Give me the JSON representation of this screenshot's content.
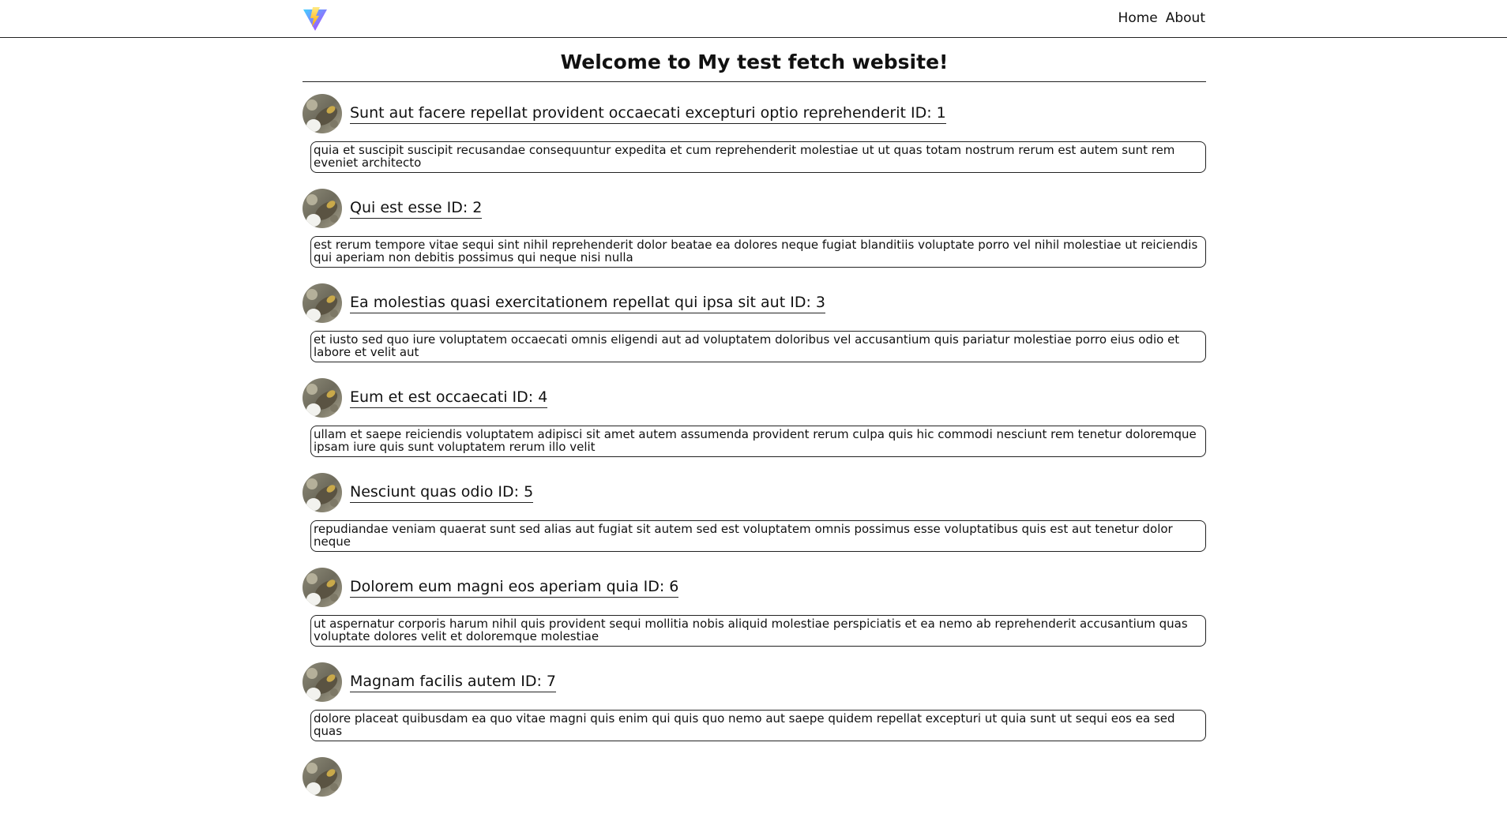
{
  "nav": {
    "logo": "vite-logo-icon",
    "links": [
      {
        "label": "Home"
      },
      {
        "label": "About"
      }
    ]
  },
  "page": {
    "title": "Welcome to My test fetch website!"
  },
  "posts": [
    {
      "title": "Sunt aut facere repellat provident occaecati excepturi optio reprehenderit ID: 1",
      "body": "quia et suscipit suscipit recusandae consequuntur expedita et cum reprehenderit molestiae ut ut quas totam nostrum rerum est autem sunt rem eveniet architecto"
    },
    {
      "title": "Qui est esse ID: 2",
      "body": "est rerum tempore vitae sequi sint nihil reprehenderit dolor beatae ea dolores neque fugiat blanditiis voluptate porro vel nihil molestiae ut reiciendis qui aperiam non debitis possimus qui neque nisi nulla"
    },
    {
      "title": "Ea molestias quasi exercitationem repellat qui ipsa sit aut ID: 3",
      "body": "et iusto sed quo iure voluptatem occaecati omnis eligendi aut ad voluptatem doloribus vel accusantium quis pariatur molestiae porro eius odio et labore et velit aut"
    },
    {
      "title": "Eum et est occaecati ID: 4",
      "body": "ullam et saepe reiciendis voluptatem adipisci sit amet autem assumenda provident rerum culpa quis hic commodi nesciunt rem tenetur doloremque ipsam iure quis sunt voluptatem rerum illo velit"
    },
    {
      "title": "Nesciunt quas odio ID: 5",
      "body": "repudiandae veniam quaerat sunt sed alias aut fugiat sit autem sed est voluptatem omnis possimus esse voluptatibus quis est aut tenetur dolor neque"
    },
    {
      "title": "Dolorem eum magni eos aperiam quia ID: 6",
      "body": "ut aspernatur corporis harum nihil quis provident sequi mollitia nobis aliquid molestiae perspiciatis et ea nemo ab reprehenderit accusantium quas voluptate dolores velit et doloremque molestiae"
    },
    {
      "title": "Magnam facilis autem ID: 7",
      "body": "dolore placeat quibusdam ea quo vitae magni quis enim qui quis quo nemo aut saepe quidem repellat excepturi ut quia sunt ut sequi eos ea sed quas"
    },
    {
      "title": "",
      "body": ""
    }
  ]
}
